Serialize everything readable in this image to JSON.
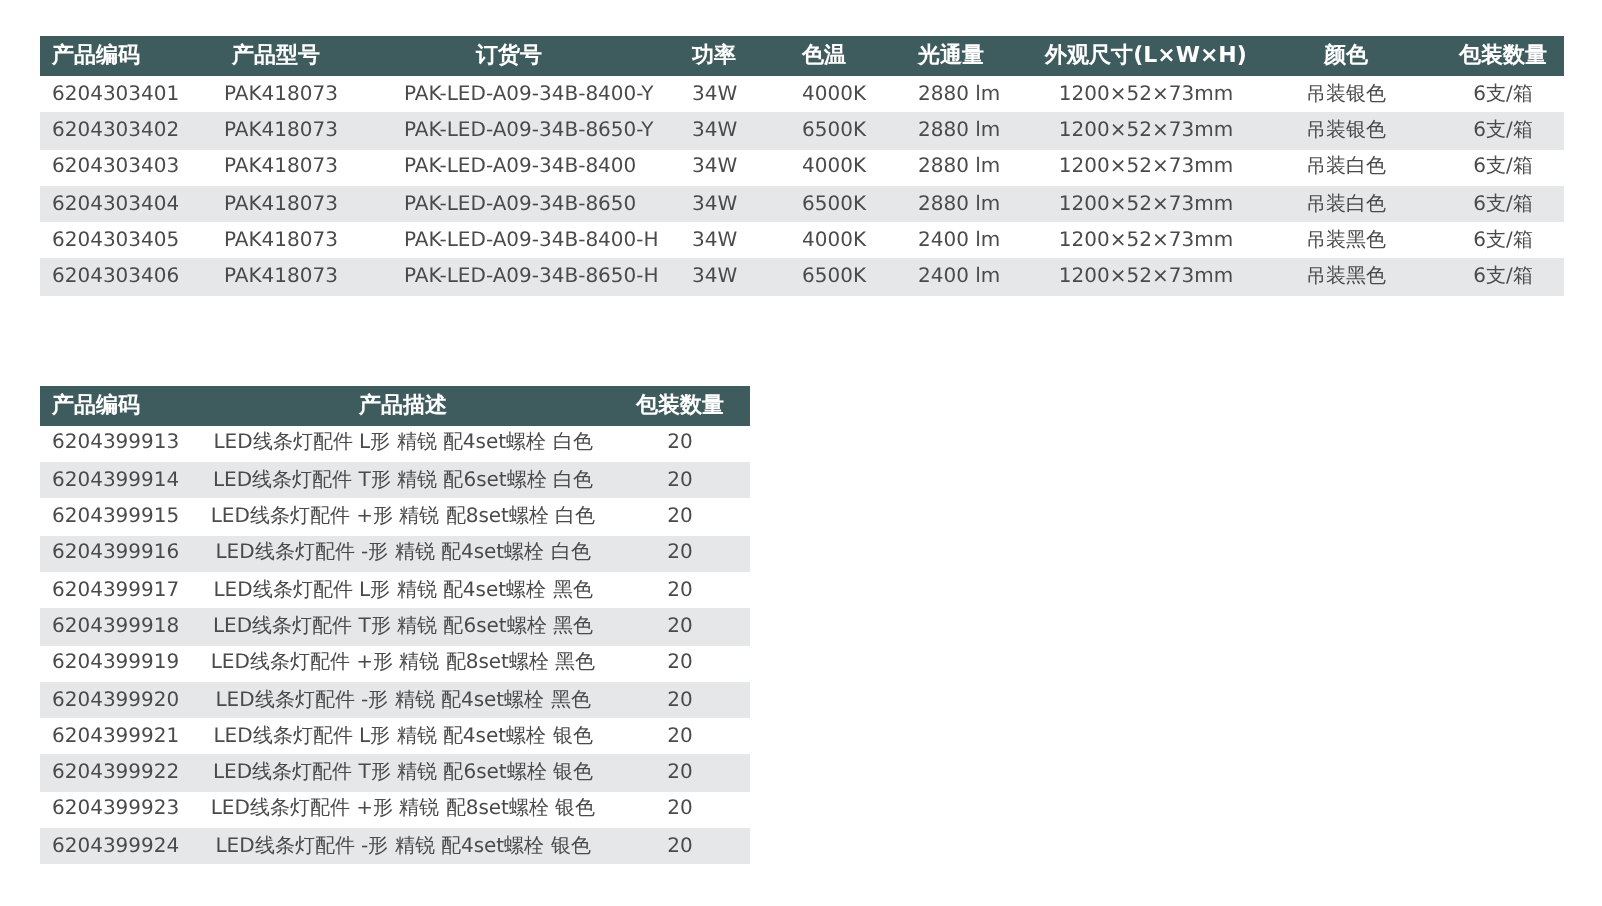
{
  "tables": [
    {
      "columns": [
        "产品编码",
        "产品型号",
        "订货号",
        "功率",
        "色温",
        "光通量",
        "外观尺寸(L×W×H)",
        "颜色",
        "包装数量"
      ],
      "rows": [
        [
          "6204303401",
          "PAK418073",
          "PAK-LED-A09-34B-8400-Y",
          "34W",
          "4000K",
          "2880 lm",
          "1200×52×73mm",
          "吊装银色",
          "6支/箱"
        ],
        [
          "6204303402",
          "PAK418073",
          "PAK-LED-A09-34B-8650-Y",
          "34W",
          "6500K",
          "2880 lm",
          "1200×52×73mm",
          "吊装银色",
          "6支/箱"
        ],
        [
          "6204303403",
          "PAK418073",
          "PAK-LED-A09-34B-8400",
          "34W",
          "4000K",
          "2880 lm",
          "1200×52×73mm",
          "吊装白色",
          "6支/箱"
        ],
        [
          "6204303404",
          "PAK418073",
          "PAK-LED-A09-34B-8650",
          "34W",
          "6500K",
          "2880 lm",
          "1200×52×73mm",
          "吊装白色",
          "6支/箱"
        ],
        [
          "6204303405",
          "PAK418073",
          "PAK-LED-A09-34B-8400-H",
          "34W",
          "4000K",
          "2400 lm",
          "1200×52×73mm",
          "吊装黑色",
          "6支/箱"
        ],
        [
          "6204303406",
          "PAK418073",
          "PAK-LED-A09-34B-8650-H",
          "34W",
          "6500K",
          "2400 lm",
          "1200×52×73mm",
          "吊装黑色",
          "6支/箱"
        ]
      ]
    },
    {
      "columns": [
        "产品编码",
        "产品描述",
        "包装数量"
      ],
      "rows": [
        [
          "6204399913",
          "LED线条灯配件 L形 精锐 配4set螺栓 白色",
          "20"
        ],
        [
          "6204399914",
          "LED线条灯配件 T形 精锐 配6set螺栓 白色",
          "20"
        ],
        [
          "6204399915",
          "LED线条灯配件 +形 精锐 配8set螺栓 白色",
          "20"
        ],
        [
          "6204399916",
          "LED线条灯配件 -形 精锐 配4set螺栓 白色",
          "20"
        ],
        [
          "6204399917",
          "LED线条灯配件 L形 精锐 配4set螺栓 黑色",
          "20"
        ],
        [
          "6204399918",
          "LED线条灯配件 T形 精锐 配6set螺栓 黑色",
          "20"
        ],
        [
          "6204399919",
          "LED线条灯配件 +形 精锐 配8set螺栓 黑色",
          "20"
        ],
        [
          "6204399920",
          "LED线条灯配件 -形 精锐 配4set螺栓 黑色",
          "20"
        ],
        [
          "6204399921",
          "LED线条灯配件 L形 精锐 配4set螺栓 银色",
          "20"
        ],
        [
          "6204399922",
          "LED线条灯配件 T形 精锐 配6set螺栓 银色",
          "20"
        ],
        [
          "6204399923",
          "LED线条灯配件 +形 精锐 配8set螺栓 银色",
          "20"
        ],
        [
          "6204399924",
          "LED线条灯配件 -形 精锐 配4set螺栓 银色",
          "20"
        ]
      ]
    }
  ]
}
